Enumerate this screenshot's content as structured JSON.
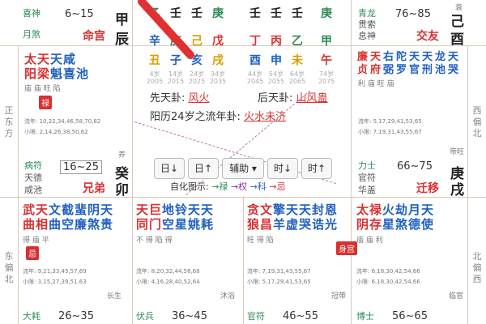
{
  "colors": {
    "red": "#d93030",
    "green": "#2e8b57",
    "blue": "#2060c0",
    "purple": "#8030a0"
  },
  "top_left": {
    "god1": "喜神",
    "god2": "月煞",
    "range": "6~15",
    "palace": "命宫",
    "stem": "甲",
    "branch": "辰"
  },
  "top_right": {
    "god1": "青龙",
    "god2": "贯索",
    "god3": "息神",
    "range": "76~85",
    "palace": "交友",
    "stem": "己",
    "branch": "酉",
    "tiny": "衰"
  },
  "center": {
    "stems_row1": [
      "乙",
      "壬",
      "壬",
      "庚",
      "壬",
      "壬",
      "壬",
      "庚"
    ],
    "stems_row2": [
      "辛",
      "庚",
      "己",
      "戊",
      "丁",
      "丙",
      "乙",
      "甲"
    ],
    "branches": [
      "丑",
      "子",
      "亥",
      "戌",
      "酉",
      "申",
      "未",
      "午"
    ],
    "years": [
      "2005",
      "2015",
      "2025",
      "2035",
      "2045",
      "2055",
      "2065",
      "2075"
    ],
    "ages": [
      "4岁",
      "14岁",
      "24岁",
      "34岁",
      "44岁",
      "54岁",
      "64岁",
      "74岁"
    ],
    "row_xian_label": "先天卦:",
    "row_xian_val": "风火",
    "row_hou_label": "后天卦:",
    "row_hou_val": "山风蛊",
    "row_liu_label": "阳历24岁之流年卦:",
    "row_liu_val": "火水未济",
    "sihua_label": "自化图示:",
    "sihua_items": [
      "→禄",
      "→权",
      "→科",
      "→忌"
    ]
  },
  "toolbar": {
    "btn1": "日↓",
    "btn2": "日↑",
    "btn3": "辅助 ▾",
    "btn4": "时↓",
    "btn5": "时↑"
  },
  "left_mid": {
    "stars": [
      "太",
      "天",
      "天",
      "咸"
    ],
    "stars2": [
      "阳",
      "梁",
      "魁",
      "喜",
      "池"
    ],
    "bright": "庙 庙 旺 陷",
    "badge": "禄",
    "liu_nian": "流年: 10,22,34,46,58,70,82",
    "xiao_xian": "小限: 2,14,26,38,50,62",
    "god1": "病符",
    "god2": "天德",
    "god3": "咸池",
    "range": "16~25",
    "palace": "兄弟",
    "stem": "癸",
    "branch": "卯",
    "tiny": "养"
  },
  "right_mid": {
    "stars1": [
      "廉",
      "天",
      "右",
      "陀",
      "天",
      "天",
      "龙",
      "天"
    ],
    "stars2": [
      "贞",
      "府",
      "弼",
      "罗",
      "官",
      "刑",
      "池",
      "哭"
    ],
    "bright": "利 庙 旺 庙",
    "liu_nian": "流年: 5,17,29,41,53,65",
    "xiao_xian": "小限: 7,19,31,43,55,67",
    "god1": "力士",
    "god2": "官符",
    "god3": "华盖",
    "range": "66~75",
    "palace": "迁移",
    "stem": "庚",
    "branch": "戌",
    "tiny": "帝旺"
  },
  "bottom": [
    {
      "s1": [
        "武",
        "天",
        "文",
        "截",
        "蜚",
        "阴",
        "天"
      ],
      "s2": [
        "曲",
        "相",
        "曲",
        "空",
        "廉",
        "煞",
        "贵"
      ],
      "bright": "得 庙 平",
      "badge": "忌",
      "liu": "流年: 9,21,33,45,57,69",
      "xiao": "小限: 3,15,27,39,51,63",
      "god": "大耗",
      "range": "26~35",
      "tiny": "长生"
    },
    {
      "s1": [
        "天",
        "巨",
        "地",
        "铃",
        "天",
        "天"
      ],
      "s2": [
        "同",
        "门",
        "空",
        "星",
        "姚",
        "耗"
      ],
      "bright": "不 得 陷 得",
      "liu": "流年: 8,20,32,44,56,68",
      "xiao": "小限: 4,16,28,40,52,64",
      "god": "伏兵",
      "range": "36~45",
      "tiny": "沐浴"
    },
    {
      "s1": [
        "贪",
        "文",
        "擎",
        "天",
        "天",
        "封",
        "恩"
      ],
      "s2": [
        "狼",
        "昌",
        "羊",
        "虚",
        "哭",
        "诰",
        "光"
      ],
      "bright": "旺 得 陷",
      "badge": "身宫",
      "liu": "流年: 7,19,31,43,55,67",
      "xiao": "小限: 5,17,29,41,53,65",
      "god": "官符",
      "range": "46~55",
      "tiny": "冠带"
    },
    {
      "s1": [
        "太",
        "禄",
        "火",
        "劫",
        "月",
        "天"
      ],
      "s2": [
        "阴",
        "存",
        "星",
        "煞",
        "德",
        "使"
      ],
      "bright": "庙 庙 利",
      "liu": "流年: 6,18,30,42,54,66",
      "xiao": "小限: 6,18,30,42,54,66",
      "god": "博士",
      "range": "56~65",
      "tiny": "临官"
    }
  ],
  "dirs": {
    "left1": "正东方",
    "left2": "东偏北",
    "right1": "西偏北",
    "right2": "北偏西"
  }
}
